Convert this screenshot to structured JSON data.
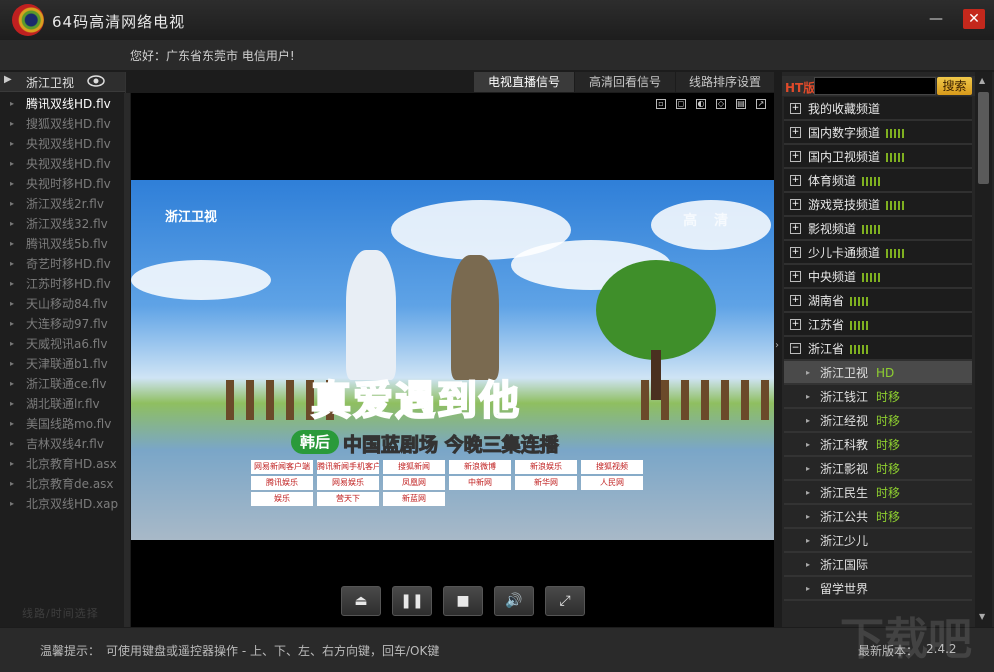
{
  "app": {
    "title": "64码高清网络电视",
    "greeting": "您好：广东省东莞市 电信用户!"
  },
  "left_panel": {
    "title": "浙江卫视",
    "items": [
      "腾讯双线HD.flv",
      "搜狐双线HD.flv",
      "央视双线HD.flv",
      "央视双线HD.flv",
      "央视时移HD.flv",
      "浙江双线2r.flv",
      "浙江双线32.flv",
      "腾讯双线5b.flv",
      "奇艺时移HD.flv",
      "江苏时移HD.flv",
      "天山移动84.flv",
      "大连移动97.flv",
      "天威视讯a6.flv",
      "天津联通b1.flv",
      "浙江联通ce.flv",
      "湖北联通lr.flv",
      "美国线路mo.flv",
      "吉林双线4r.flv",
      "北京教育HD.asx",
      "北京教育de.asx",
      "北京双线HD.xap"
    ],
    "footer": "线路/时间选择"
  },
  "tabs": [
    "电视直播信号",
    "高清回看信号",
    "线路排序设置"
  ],
  "video": {
    "station": "浙江卫视",
    "hd_mark": "高 清",
    "show_title": "真爱遇到他",
    "badge": "韩后",
    "subtitle": "中国蓝剧场 今晚三集连播",
    "sponsors": [
      "网易新闻客户端",
      "腾讯新闻手机客户端",
      "搜狐新闻",
      "新浪微博",
      "新浪娱乐",
      "搜狐视频",
      "腾讯娱乐",
      "网易娱乐",
      "凤凰网",
      "中新网",
      "新华网",
      "人民网",
      "娱乐",
      "营天下",
      "新蓝网"
    ]
  },
  "controls": {
    "eject": "⏏",
    "pause": "❚❚",
    "stop": "■",
    "volume": "🔊",
    "fullscreen": "⤢"
  },
  "right_panel": {
    "ht_label": "HT版",
    "search_placeholder": "",
    "search_button": "搜索",
    "categories": [
      {
        "label": "我的收藏频道",
        "signal": false,
        "box": "+"
      },
      {
        "label": "国内数字频道",
        "signal": true,
        "box": "+"
      },
      {
        "label": "国内卫视频道",
        "signal": true,
        "box": "+"
      },
      {
        "label": "体育频道",
        "signal": true,
        "box": "+"
      },
      {
        "label": "游戏竞技频道",
        "signal": true,
        "box": "+"
      },
      {
        "label": "影视频道",
        "signal": true,
        "box": "+"
      },
      {
        "label": "少儿卡通频道",
        "signal": true,
        "box": "+"
      },
      {
        "label": "中央频道",
        "signal": true,
        "box": "+"
      },
      {
        "label": "湖南省",
        "signal": true,
        "box": "+"
      },
      {
        "label": "江苏省",
        "signal": true,
        "box": "+"
      },
      {
        "label": "浙江省",
        "signal": true,
        "box": "−"
      }
    ],
    "channels": [
      {
        "label": "浙江卫视",
        "tag": "HD"
      },
      {
        "label": "浙江钱江",
        "tag": "时移"
      },
      {
        "label": "浙江经视",
        "tag": "时移"
      },
      {
        "label": "浙江科教",
        "tag": "时移"
      },
      {
        "label": "浙江影视",
        "tag": "时移"
      },
      {
        "label": "浙江民生",
        "tag": "时移"
      },
      {
        "label": "浙江公共",
        "tag": "时移"
      },
      {
        "label": "浙江少儿",
        "tag": ""
      },
      {
        "label": "浙江国际",
        "tag": ""
      },
      {
        "label": "留学世界",
        "tag": ""
      }
    ]
  },
  "bottom": {
    "hint_label": "温馨提示：",
    "hint_text": "可使用键盘或遥控器操作 - 上、下、左、右方向键，回车/OK键",
    "version_label": "最新版本：",
    "version": "2.4.2",
    "watermark": "下载吧"
  },
  "colors": {
    "accent_green": "#8fd030",
    "close_red": "#c4281c",
    "search_gold": "#e8b030"
  }
}
